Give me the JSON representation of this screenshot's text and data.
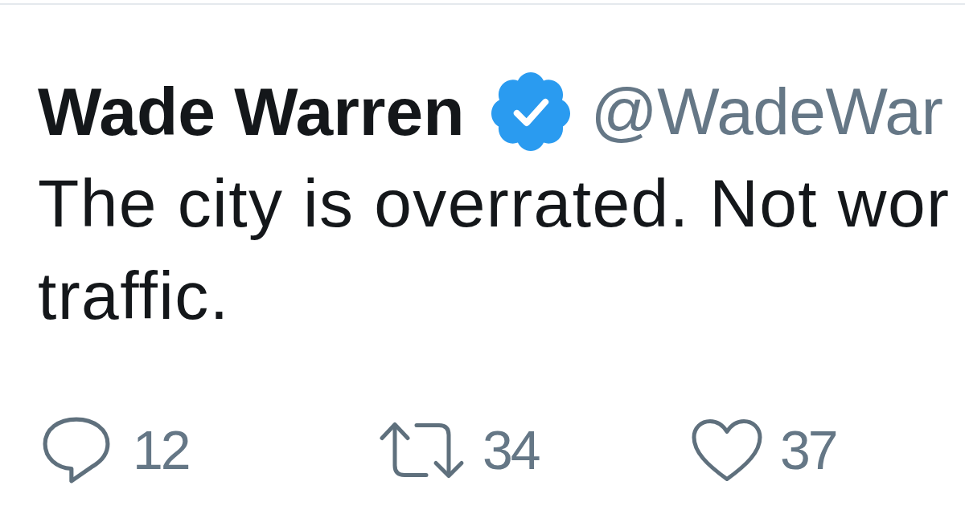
{
  "tweet": {
    "author": {
      "name": "Wade Warren",
      "verified": true,
      "handle": "@WadeWar"
    },
    "text_lines": [
      "The city is overrated. Not wor",
      "traffic."
    ],
    "actions": [
      {
        "kind": "reply",
        "count": "12"
      },
      {
        "kind": "retweet",
        "count": "34"
      },
      {
        "kind": "like",
        "count": "37"
      }
    ]
  }
}
